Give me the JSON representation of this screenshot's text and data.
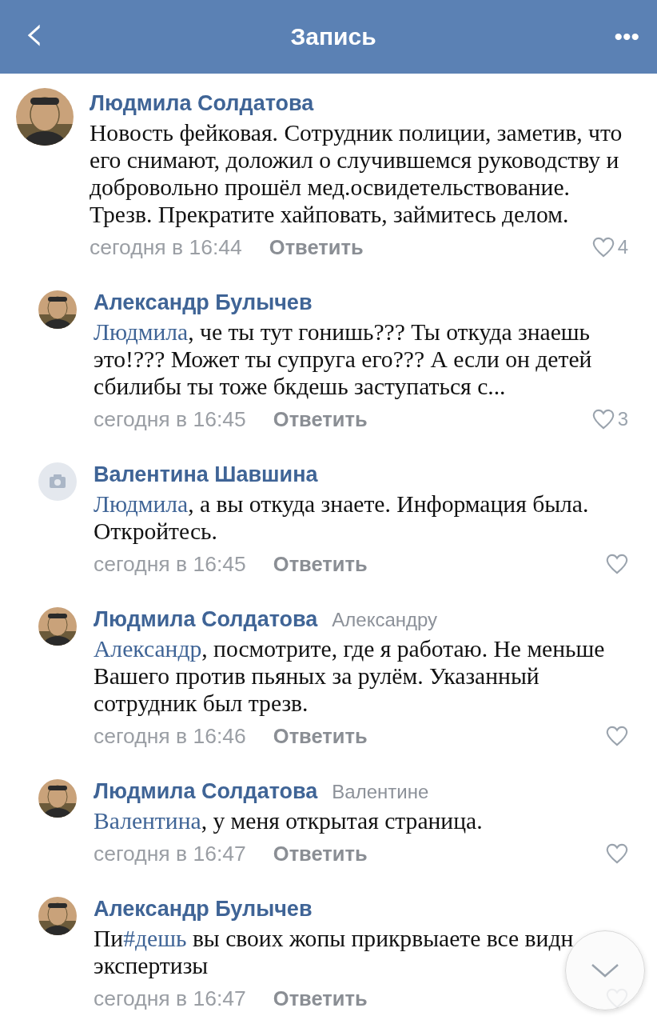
{
  "header": {
    "title": "Запись",
    "back": "‹",
    "more": "•••"
  },
  "comments": [
    {
      "kind": "comment",
      "has_photo": true,
      "author": "Людмила Солдатова",
      "segments": [
        {
          "kind": "text",
          "text": "Новость фейковая. Сотрудник полиции, заметив, что его снимают, доложил о случившемся руководству и добровольно прошёл мед.освидетельствование. Трезв. Прекратите хайповать, займитесь делом."
        }
      ],
      "time": "сегодня в 16:44",
      "reply_label": "Ответить",
      "likes": "4"
    },
    {
      "kind": "reply",
      "has_photo": true,
      "author": "Александр Булычев",
      "segments": [
        {
          "kind": "link",
          "text": "Людмила"
        },
        {
          "kind": "text",
          "text": ", че ты тут гонишь??? Ты откуда знаешь это!??? Может ты супруга его??? А если он детей сбилибы ты тоже бкдешь заступаться с..."
        }
      ],
      "time": "сегодня в 16:45",
      "reply_label": "Ответить",
      "likes": "3"
    },
    {
      "kind": "reply",
      "has_photo": false,
      "author": "Валентина Шавшина",
      "segments": [
        {
          "kind": "link",
          "text": "Людмила"
        },
        {
          "kind": "text",
          "text": ", а вы откуда знаете. Информация была. Откройтесь."
        }
      ],
      "time": "сегодня в 16:45",
      "reply_label": "Ответить"
    },
    {
      "kind": "reply",
      "has_photo": true,
      "author": "Людмила Солдатова",
      "addressee": "Александру",
      "segments": [
        {
          "kind": "link",
          "text": "Александр"
        },
        {
          "kind": "text",
          "text": ", посмотрите, где я работаю. Не меньше Вашего против пьяных за рулём. Указанный сотрудник был трезв."
        }
      ],
      "time": "сегодня в 16:46",
      "reply_label": "Ответить"
    },
    {
      "kind": "reply",
      "has_photo": true,
      "author": "Людмила Солдатова",
      "addressee": "Валентине",
      "segments": [
        {
          "kind": "link",
          "text": "Валентина"
        },
        {
          "kind": "text",
          "text": ", у меня открытая страница."
        }
      ],
      "time": "сегодня в 16:47",
      "reply_label": "Ответить"
    },
    {
      "kind": "reply",
      "has_photo": true,
      "author": "Александр Булычев",
      "segments": [
        {
          "kind": "text",
          "text": "Пи"
        },
        {
          "kind": "link",
          "text": "#дешь"
        },
        {
          "kind": "text",
          "text": " вы своих жопы прикрвыаете все видн\nэкспертизы"
        }
      ],
      "time": "сегодня в 16:47",
      "reply_label": "Ответить"
    }
  ]
}
